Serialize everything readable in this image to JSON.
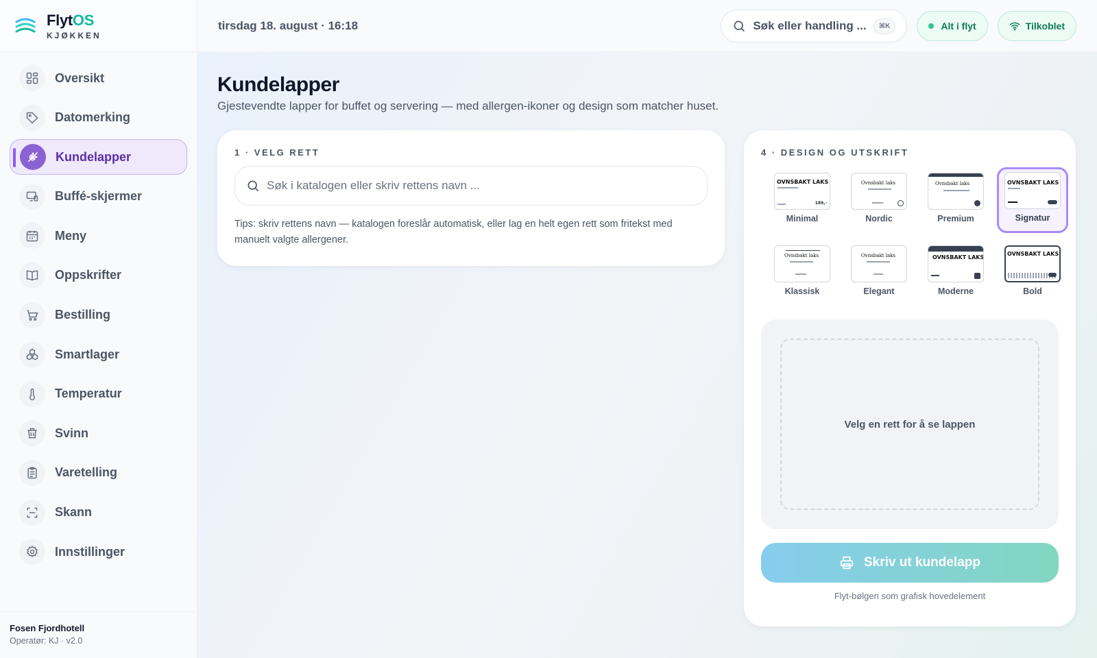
{
  "brand": {
    "name_main": "Flyt",
    "name_accent": "OS",
    "subtitle": "KJØKKEN"
  },
  "header": {
    "datetime": "tirsdag 18. august · 16:18",
    "search_label": "Søk eller handling ...",
    "shortcut": "⌘K",
    "status_flow": "Alt i flyt",
    "status_connection": "Tilkoblet"
  },
  "sidebar": {
    "items": [
      {
        "label": "Oversikt",
        "icon": "grid-icon"
      },
      {
        "label": "Datomerking",
        "icon": "tag-icon"
      },
      {
        "label": "Kundelapper",
        "icon": "wheat-icon",
        "active": true
      },
      {
        "label": "Buffé-skjermer",
        "icon": "monitor-icon"
      },
      {
        "label": "Meny",
        "icon": "calendar-icon"
      },
      {
        "label": "Oppskrifter",
        "icon": "book-icon"
      },
      {
        "label": "Bestilling",
        "icon": "cart-icon"
      },
      {
        "label": "Smartlager",
        "icon": "boxes-icon"
      },
      {
        "label": "Temperatur",
        "icon": "thermometer-icon"
      },
      {
        "label": "Svinn",
        "icon": "trash-icon"
      },
      {
        "label": "Varetelling",
        "icon": "clipboard-icon"
      },
      {
        "label": "Skann",
        "icon": "scan-icon"
      },
      {
        "label": "Innstillinger",
        "icon": "gear-icon"
      }
    ],
    "footer": {
      "hotel": "Fosen Fjordhotell",
      "operator": "Operatør: KJ · v2.0"
    }
  },
  "page": {
    "title": "Kundelapper",
    "subtitle": "Gjestevendte lapper for buffet og servering — med allergen-ikoner og design som matcher huset."
  },
  "choose_dish": {
    "step_label": "1 · VELG RETT",
    "search_placeholder": "Søk i katalogen eller skriv rettens navn ...",
    "tips": "Tips: skriv rettens navn — katalogen foreslår automatisk, eller lag en helt egen rett som fritekst med manuelt valgte allergener."
  },
  "design": {
    "step_label": "4 · DESIGN OG UTSKRIFT",
    "sample_title": "OVNSBAKT LAKS",
    "sample_title_script": "Ovnsbakt laks",
    "sample_price": "189,-",
    "options": [
      {
        "name": "Minimal"
      },
      {
        "name": "Nordic"
      },
      {
        "name": "Premium"
      },
      {
        "name": "Signatur",
        "selected": true
      },
      {
        "name": "Klassisk"
      },
      {
        "name": "Elegant"
      },
      {
        "name": "Moderne"
      },
      {
        "name": "Bold"
      }
    ],
    "preview_placeholder": "Velg en rett for å se lappen",
    "print_button": "Skriv ut kundelapp",
    "caption": "Flyt-bølgen som grafisk hovedelement"
  },
  "colors": {
    "accent_purple": "#8a63d2",
    "brand_teal": "#14b8a6",
    "status_green": "#34c38f",
    "print_gradient_start": "#86cdee",
    "print_gradient_end": "#82d6c0"
  }
}
